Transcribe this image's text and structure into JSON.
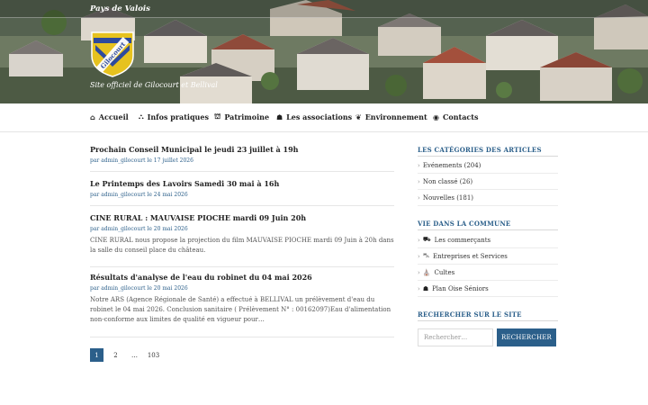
{
  "header": {
    "region": "Pays de Valois",
    "crest_text": "Gilocourt",
    "tagline": "Site officiel de Gilocourt et Bellival"
  },
  "nav": {
    "items": [
      {
        "label": "Accueil",
        "icon": "home-icon"
      },
      {
        "label": "Infos pratiques",
        "icon": "sitemap-icon"
      },
      {
        "label": "Patrimoine",
        "icon": "landmark-icon"
      },
      {
        "label": "Les associations",
        "icon": "users-icon"
      },
      {
        "label": "Environnement",
        "icon": "leaf-icon"
      },
      {
        "label": "Contacts",
        "icon": "eye-icon"
      }
    ]
  },
  "posts": [
    {
      "title": "Prochain Conseil Municipal le jeudi 23 juillet à 19h",
      "meta": "par admin_gilocourt le 17 juillet 2026",
      "excerpt": ""
    },
    {
      "title": "Le Printemps des Lavoirs Samedi 30 mai à 16h",
      "meta": "par admin_gilocourt le 24 mai 2026",
      "excerpt": ""
    },
    {
      "title": "CINE RURAL : MAUVAISE PIOCHE mardi 09 Juin 20h",
      "meta": "par admin_gilocourt le 20 mai 2026",
      "excerpt": "CINE RURAL nous propose la projection du film MAUVAISE PIOCHE mardi 09 Juin à 20h dans la salle du conseil place du château."
    },
    {
      "title": "Résultats d'analyse de l'eau du robinet du 04 mai 2026",
      "meta": "par admin_gilocourt le 20 mai 2026",
      "excerpt": "Notre ARS (Agence Régionale de Santé) a effectué à BELLIVAL un prélèvement d'eau du robinet le 04 mai 2026. Conclusion sanitaire ( Prélèvement N° : 00162097)Eau d'alimentation non-conforme aux limites de qualité en vigueur pour…"
    }
  ],
  "pagination": [
    "1",
    "2",
    "…",
    "103"
  ],
  "sidebar": {
    "categories_title": "LES CATÉGORIES DES ARTICLES",
    "categories": [
      {
        "label": "Evénements (204)"
      },
      {
        "label": "Non classé (26)"
      },
      {
        "label": "Nouvelles (181)"
      }
    ],
    "community_title": "VIE DANS LA COMMUNE",
    "community": [
      {
        "label": "Les commerçants",
        "icon": "cart-icon"
      },
      {
        "label": "Entreprises et Services",
        "icon": "truck-icon"
      },
      {
        "label": "Cultes",
        "icon": "church-icon"
      },
      {
        "label": "Plan Oise Séniors",
        "icon": "users-icon"
      }
    ],
    "search_title": "RECHERCHER SUR LE SITE",
    "search_placeholder": "Rechercher…",
    "search_button": "RECHERCHER"
  },
  "colors": {
    "accent": "#2b5f8a",
    "crest_blue": "#2d4a9e",
    "crest_gold": "#e6c21f"
  }
}
